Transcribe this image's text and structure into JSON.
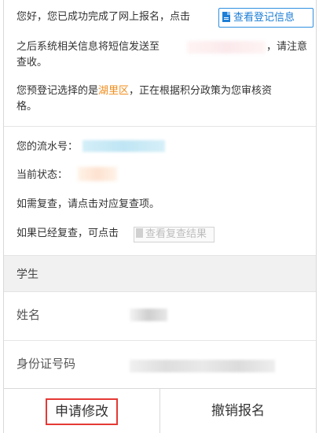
{
  "notice": {
    "line1": "您好，您已成功完成了网上报名，点击",
    "view_button": "查看登记信息",
    "line2a": "之后系统相关信息将短信发送至",
    "line2b": "，请注意",
    "line3": "查收。",
    "line4a": "您预登记选择的是",
    "district": "湖里区",
    "line4b": "，正在根据积分政策为您审核资",
    "line5": "格。"
  },
  "status": {
    "serial_label": "您的流水号：",
    "state_label": "当前状态：",
    "recheck_text": "如需复查，请点击对应复查项。",
    "rechecked_text": "如果已经复查，可点击",
    "view_result_button": "查看复查结果"
  },
  "group": {
    "title": "学生",
    "fields": [
      {
        "label": "姓名"
      },
      {
        "label": "身份证号码"
      }
    ]
  },
  "actions": {
    "modify": "申请修改",
    "cancel": "撤销报名"
  },
  "colors": {
    "accent_blue": "#1e7fd6",
    "district_orange": "#f08c1a",
    "highlight_red": "#e53935"
  }
}
